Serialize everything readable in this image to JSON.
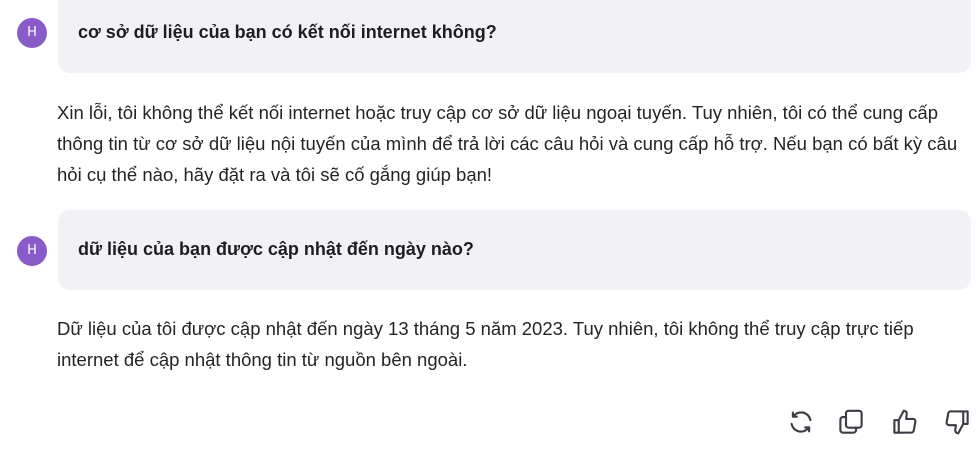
{
  "messages": [
    {
      "role": "user",
      "avatar_initial": "H",
      "text": "cơ sở dữ liệu của bạn có kết nối internet không?"
    },
    {
      "role": "assistant",
      "text": "Xin lỗi, tôi không thể kết nối internet hoặc truy cập cơ sở dữ liệu ngoại tuyến. Tuy nhiên, tôi có thể cung cấp thông tin từ cơ sở dữ liệu nội tuyến của mình để trả lời các câu hỏi và cung cấp hỗ trợ. Nếu bạn có bất kỳ câu hỏi cụ thể nào, hãy đặt ra và tôi sẽ cố gắng giúp bạn!"
    },
    {
      "role": "user",
      "avatar_initial": "H",
      "text": "dữ liệu của bạn được cập nhật đến ngày nào?"
    },
    {
      "role": "assistant",
      "text": "Dữ liệu của tôi được cập nhật đến ngày 13 tháng 5 năm 2023. Tuy nhiên, tôi không thể truy cập trực tiếp internet để cập nhật thông tin từ nguồn bên ngoài."
    }
  ],
  "actions": [
    {
      "name": "regenerate",
      "icon": "refresh-icon"
    },
    {
      "name": "copy",
      "icon": "copy-icon"
    },
    {
      "name": "thumbs-up",
      "icon": "thumbs-up-icon"
    },
    {
      "name": "thumbs-down",
      "icon": "thumbs-down-icon"
    }
  ],
  "colors": {
    "avatar_bg": "#8a5cc7",
    "bubble_bg": "#f2f2f6",
    "text": "#242428",
    "icon": "#3c3c44"
  }
}
